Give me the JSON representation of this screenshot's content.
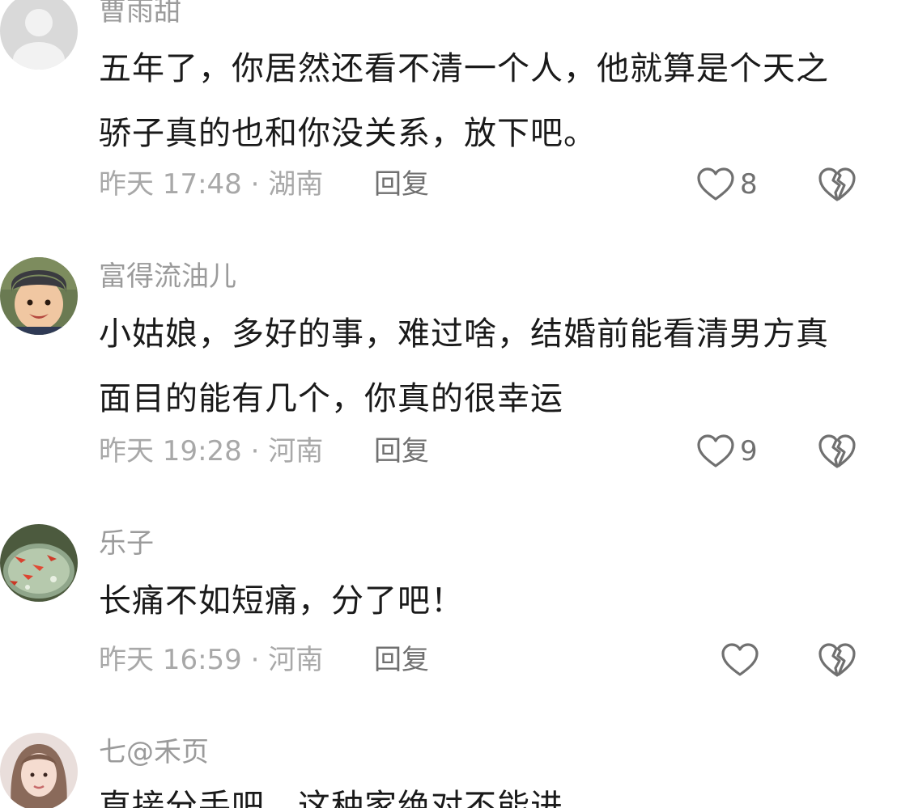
{
  "comments": [
    {
      "username": "曹雨甜",
      "text": "五年了，你居然还看不清一个人，他就算是个天之骄子真的也和你没关系，放下吧。",
      "meta": "昨天 17:48 · 湖南",
      "reply_label": "回复",
      "likes": "8",
      "avatar_icon": "default-avatar-icon"
    },
    {
      "username": "富得流油儿",
      "text": "小姑娘，多好的事，难过啥，结婚前能看清男方真面目的能有几个，你真的很幸运",
      "meta": "昨天 19:28 · 河南",
      "reply_label": "回复",
      "likes": "9",
      "avatar_icon": "child-photo-avatar"
    },
    {
      "username": "乐子",
      "text": "长痛不如短痛，分了吧！",
      "meta": "昨天 16:59 · 河南",
      "reply_label": "回复",
      "likes": "",
      "avatar_icon": "goldfish-photo-avatar"
    },
    {
      "username": "七@禾页",
      "text": "直接分手吧，这种家绝对不能进",
      "avatar_icon": "woman-photo-avatar"
    }
  ],
  "icons": {
    "like": "heart-outline-icon",
    "dislike": "broken-heart-icon"
  },
  "colors": {
    "username": "#9b9b9b",
    "text": "#1a1a1a",
    "meta": "#a8a8a8",
    "icon": "#707070"
  }
}
